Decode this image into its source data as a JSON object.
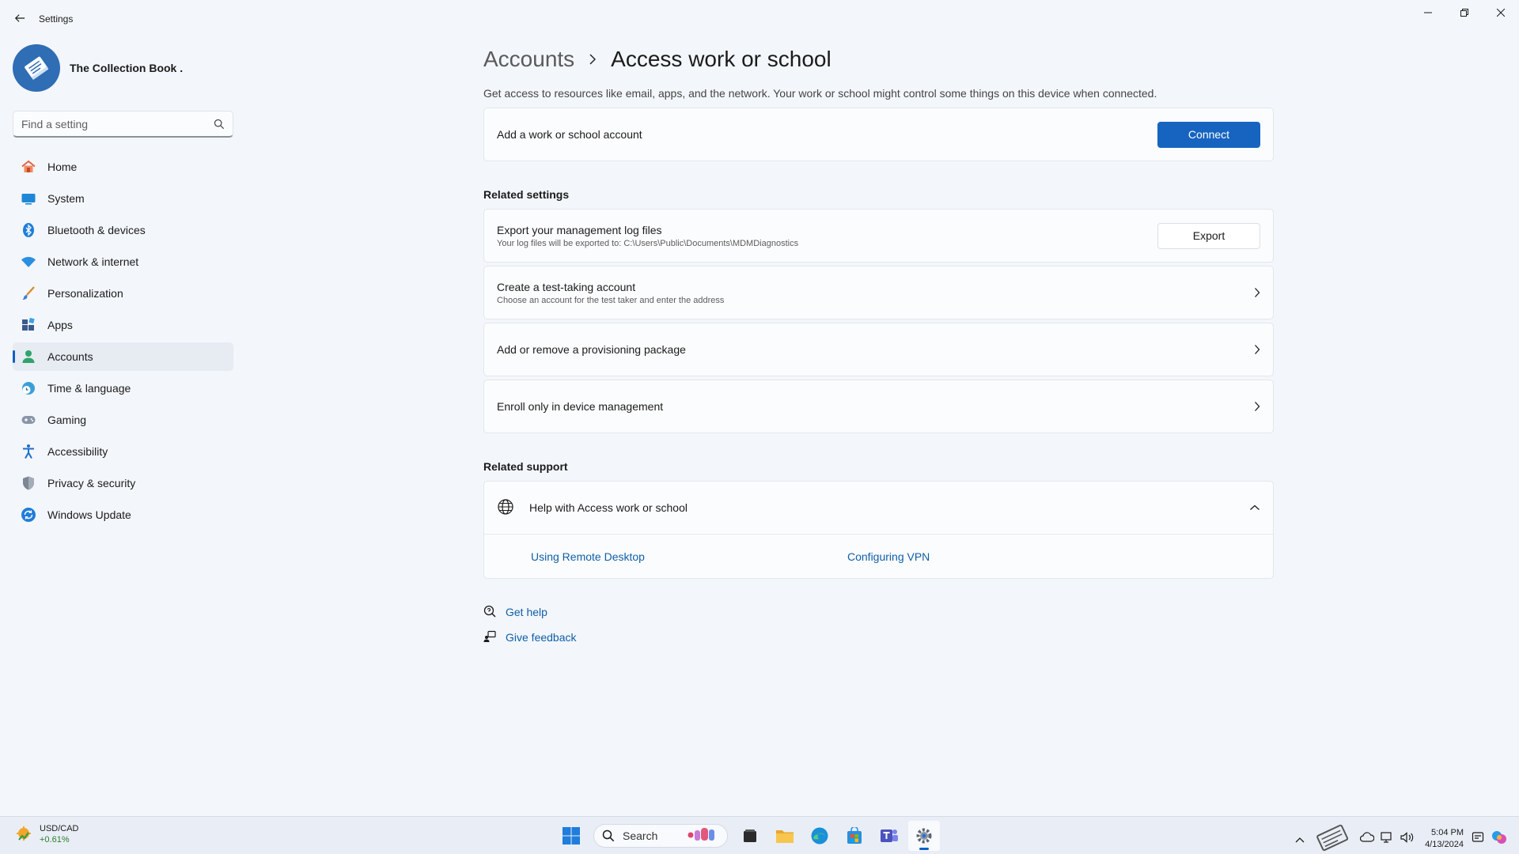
{
  "window": {
    "title": "Settings",
    "controls": [
      "minimize",
      "restore",
      "close"
    ]
  },
  "profile": {
    "name": "The Collection Book ."
  },
  "search": {
    "placeholder": "Find a setting"
  },
  "nav": {
    "items": [
      {
        "label": "Home",
        "icon": "home-icon",
        "active": false
      },
      {
        "label": "System",
        "icon": "system-icon",
        "active": false
      },
      {
        "label": "Bluetooth & devices",
        "icon": "bluetooth-icon",
        "active": false
      },
      {
        "label": "Network & internet",
        "icon": "wifi-icon",
        "active": false
      },
      {
        "label": "Personalization",
        "icon": "brush-icon",
        "active": false
      },
      {
        "label": "Apps",
        "icon": "apps-icon",
        "active": false
      },
      {
        "label": "Accounts",
        "icon": "accounts-icon",
        "active": true
      },
      {
        "label": "Time & language",
        "icon": "clock-globe-icon",
        "active": false
      },
      {
        "label": "Gaming",
        "icon": "gamepad-icon",
        "active": false
      },
      {
        "label": "Accessibility",
        "icon": "accessibility-icon",
        "active": false
      },
      {
        "label": "Privacy & security",
        "icon": "shield-icon",
        "active": false
      },
      {
        "label": "Windows Update",
        "icon": "update-icon",
        "active": false
      }
    ]
  },
  "breadcrumb": {
    "parent": "Accounts",
    "current": "Access work or school"
  },
  "description": "Get access to resources like email, apps, and the network. Your work or school might control some things on this device when connected.",
  "add_account": {
    "label": "Add a work or school account",
    "button": "Connect"
  },
  "related_settings": {
    "title": "Related settings",
    "export": {
      "title": "Export your management log files",
      "subtitle": "Your log files will be exported to: C:\\Users\\Public\\Documents\\MDMDiagnostics",
      "button": "Export"
    },
    "test_account": {
      "title": "Create a test-taking account",
      "subtitle": "Choose an account for the test taker and enter the address"
    },
    "provisioning": {
      "title": "Add or remove a provisioning package"
    },
    "enroll": {
      "title": "Enroll only in device management"
    }
  },
  "related_support": {
    "title": "Related support",
    "help_title": "Help with Access work or school",
    "links": [
      "Using Remote Desktop",
      "Configuring VPN"
    ]
  },
  "footer_links": {
    "get_help": "Get help",
    "give_feedback": "Give feedback"
  },
  "taskbar": {
    "widget": {
      "title": "USD/CAD",
      "change": "+0.61%"
    },
    "search_label": "Search",
    "clock": {
      "time": "5:04 PM",
      "date": "4/13/2024"
    }
  },
  "colors": {
    "accent": "#1664c0",
    "link": "#0f5fa8",
    "background": "#f3f6fb"
  }
}
